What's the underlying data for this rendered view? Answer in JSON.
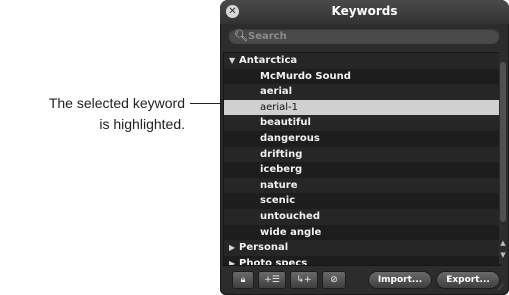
{
  "callout": {
    "line1": "The selected keyword",
    "line2": "is highlighted."
  },
  "window": {
    "title": "Keywords",
    "close_icon": "close-icon"
  },
  "search": {
    "placeholder": "Search",
    "value": "",
    "icon": "magnifier-icon"
  },
  "keywords": {
    "rows": [
      {
        "label": "Antarctica",
        "level": 0,
        "expanded": true
      },
      {
        "label": "McMurdo Sound",
        "level": 1
      },
      {
        "label": "aerial",
        "level": 1
      },
      {
        "label": "aerial-1",
        "level": 1,
        "selected": true
      },
      {
        "label": "beautiful",
        "level": 1
      },
      {
        "label": "dangerous",
        "level": 1
      },
      {
        "label": "drifting",
        "level": 1
      },
      {
        "label": "iceberg",
        "level": 1
      },
      {
        "label": "nature",
        "level": 1
      },
      {
        "label": "scenic",
        "level": 1
      },
      {
        "label": "untouched",
        "level": 1
      },
      {
        "label": "wide angle",
        "level": 1
      },
      {
        "label": "Personal",
        "level": 0,
        "expanded": false
      },
      {
        "label": "Photo specs",
        "level": 0,
        "expanded": false
      }
    ]
  },
  "toolbar": {
    "lock_icon": "lock-icon",
    "add_keyword_icon": "add-keyword-icon",
    "add_subkeyword_icon": "add-subkeyword-icon",
    "remove_icon": "remove-icon",
    "import_label": "Import...",
    "export_label": "Export..."
  },
  "colors": {
    "panel_bg": "#2c2c2c",
    "row_selected": "#d0d0d0",
    "text": "#f0f0f0"
  }
}
